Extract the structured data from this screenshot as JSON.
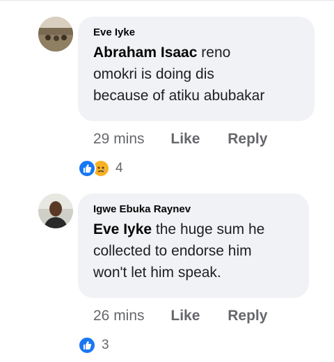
{
  "comments": [
    {
      "author": "Eve Iyke",
      "mention": "Abraham Isaac",
      "text_lines": [
        "reno",
        "omokri is doing dis",
        "because of atiku abubakar"
      ],
      "time": "29 mins",
      "like_label": "Like",
      "reply_label": "Reply",
      "reactions": [
        "like-icon",
        "sad-icon"
      ],
      "reaction_count": "4"
    },
    {
      "author": "Igwe Ebuka Raynev",
      "mention": "Eve Iyke",
      "text_lines": [
        "the huge sum he",
        "collected to endorse him",
        "won't let him speak."
      ],
      "time": "26 mins",
      "like_label": "Like",
      "reply_label": "Reply",
      "reactions": [
        "like-icon"
      ],
      "reaction_count": "3"
    }
  ],
  "colors": {
    "bubble": "#f0f2f5",
    "meta_text": "#65676b",
    "like_blue": "#1877f2",
    "sad_yellow": "#f7b125"
  }
}
